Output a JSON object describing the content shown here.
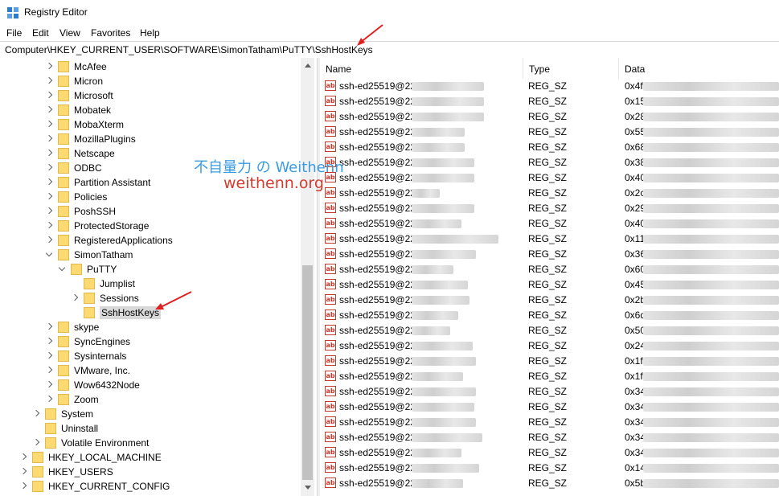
{
  "window": {
    "title": "Registry Editor"
  },
  "menu": [
    "File",
    "Edit",
    "View",
    "Favorites",
    "Help"
  ],
  "address": "Computer\\HKEY_CURRENT_USER\\SOFTWARE\\SimonTatham\\PuTTY\\SshHostKeys",
  "tree": [
    {
      "label": "McAfee",
      "expander": "right"
    },
    {
      "label": "Micron",
      "expander": "right"
    },
    {
      "label": "Microsoft",
      "expander": "right"
    },
    {
      "label": "Mobatek",
      "expander": "right"
    },
    {
      "label": "MobaXterm",
      "expander": "right"
    },
    {
      "label": "MozillaPlugins",
      "expander": "right"
    },
    {
      "label": "Netscape",
      "expander": "right"
    },
    {
      "label": "ODBC",
      "expander": "right"
    },
    {
      "label": "Partition Assistant",
      "expander": "right"
    },
    {
      "label": "Policies",
      "expander": "right"
    },
    {
      "label": "PoshSSH",
      "expander": "right"
    },
    {
      "label": "ProtectedStorage",
      "expander": "right"
    },
    {
      "label": "RegisteredApplications",
      "expander": "right"
    },
    {
      "label": "SimonTatham",
      "expander": "down"
    },
    {
      "label": "PuTTY",
      "expander": "down"
    },
    {
      "label": "Jumplist",
      "expander": "none"
    },
    {
      "label": "Sessions",
      "expander": "right"
    },
    {
      "label": "SshHostKeys",
      "expander": "none",
      "selected": true
    },
    {
      "label": "skype",
      "expander": "right"
    },
    {
      "label": "SyncEngines",
      "expander": "right"
    },
    {
      "label": "Sysinternals",
      "expander": "right"
    },
    {
      "label": "VMware, Inc.",
      "expander": "right"
    },
    {
      "label": "Wow6432Node",
      "expander": "right"
    },
    {
      "label": "Zoom",
      "expander": "right"
    },
    {
      "label": "System",
      "expander": "right"
    },
    {
      "label": "Uninstall",
      "expander": "none"
    },
    {
      "label": "Volatile Environment",
      "expander": "right"
    },
    {
      "label": "HKEY_LOCAL_MACHINE",
      "expander": "right"
    },
    {
      "label": "HKEY_USERS",
      "expander": "right"
    },
    {
      "label": "HKEY_CURRENT_CONFIG",
      "expander": "right"
    }
  ],
  "columns": [
    "Name",
    "Type",
    "Data"
  ],
  "values": [
    {
      "name": "ssh-ed25519@22:",
      "type": "REG_SZ",
      "data": "0x4f"
    },
    {
      "name": "ssh-ed25519@22:",
      "type": "REG_SZ",
      "data": "0x15"
    },
    {
      "name": "ssh-ed25519@22:",
      "type": "REG_SZ",
      "data": "0x28"
    },
    {
      "name": "ssh-ed25519@22:",
      "type": "REG_SZ",
      "data": "0x55"
    },
    {
      "name": "ssh-ed25519@22:",
      "type": "REG_SZ",
      "data": "0x68"
    },
    {
      "name": "ssh-ed25519@22:",
      "type": "REG_SZ",
      "data": "0x38"
    },
    {
      "name": "ssh-ed25519@22:",
      "type": "REG_SZ",
      "data": "0x40"
    },
    {
      "name": "ssh-ed25519@22:",
      "type": "REG_SZ",
      "data": "0x2c"
    },
    {
      "name": "ssh-ed25519@22:",
      "type": "REG_SZ",
      "data": "0x29"
    },
    {
      "name": "ssh-ed25519@22:",
      "type": "REG_SZ",
      "data": "0x40"
    },
    {
      "name": "ssh-ed25519@22:",
      "type": "REG_SZ",
      "data": "0x11"
    },
    {
      "name": "ssh-ed25519@22:",
      "type": "REG_SZ",
      "data": "0x36"
    },
    {
      "name": "ssh-ed25519@22:",
      "type": "REG_SZ",
      "data": "0x60"
    },
    {
      "name": "ssh-ed25519@22:",
      "type": "REG_SZ",
      "data": "0x45"
    },
    {
      "name": "ssh-ed25519@22:",
      "type": "REG_SZ",
      "data": "0x2b"
    },
    {
      "name": "ssh-ed25519@22:",
      "type": "REG_SZ",
      "data": "0x6d"
    },
    {
      "name": "ssh-ed25519@22:",
      "type": "REG_SZ",
      "data": "0x50"
    },
    {
      "name": "ssh-ed25519@22:",
      "type": "REG_SZ",
      "data": "0x24"
    },
    {
      "name": "ssh-ed25519@22:",
      "type": "REG_SZ",
      "data": "0x1f"
    },
    {
      "name": "ssh-ed25519@22:",
      "type": "REG_SZ",
      "data": "0x1f"
    },
    {
      "name": "ssh-ed25519@22:",
      "type": "REG_SZ",
      "data": "0x34"
    },
    {
      "name": "ssh-ed25519@22:",
      "type": "REG_SZ",
      "data": "0x34"
    },
    {
      "name": "ssh-ed25519@22:",
      "type": "REG_SZ",
      "data": "0x34"
    },
    {
      "name": "ssh-ed25519@22:",
      "type": "REG_SZ",
      "data": "0x34"
    },
    {
      "name": "ssh-ed25519@22:",
      "type": "REG_SZ",
      "data": "0x34"
    },
    {
      "name": "ssh-ed25519@22:",
      "type": "REG_SZ",
      "data": "0x14"
    },
    {
      "name": "ssh-ed25519@22:",
      "type": "REG_SZ",
      "data": "0x5b"
    }
  ],
  "watermark": {
    "line1": "不自量力 の Weithenn",
    "line2": "weithenn.org"
  },
  "colors": {
    "folder": "#fbd973",
    "selection": "#d9d9d9",
    "annotation_arrow": "#e02020",
    "watermark_blue": "#3a9be0",
    "watermark_red": "#d23b2f"
  }
}
